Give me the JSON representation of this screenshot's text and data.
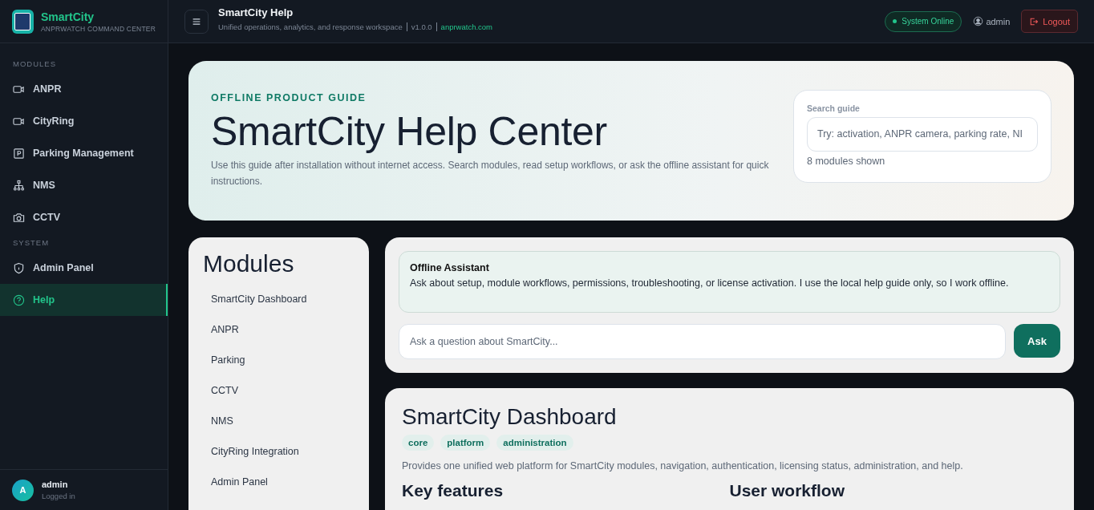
{
  "brand": {
    "name": "SmartCity",
    "subtitle": "ANPRWATCH COMMAND CENTER"
  },
  "sidebar": {
    "sections": [
      {
        "title": "MODULES",
        "items": [
          {
            "label": "ANPR",
            "kind": "camera",
            "selected": false
          },
          {
            "label": "CityRing",
            "kind": "camera",
            "selected": false
          },
          {
            "label": "Parking Management",
            "kind": "parking",
            "selected": false
          },
          {
            "label": "NMS",
            "kind": "network",
            "selected": false
          },
          {
            "label": "CCTV",
            "kind": "photo",
            "selected": false
          }
        ]
      },
      {
        "title": "SYSTEM",
        "items": [
          {
            "label": "Admin Panel",
            "kind": "shield",
            "selected": false
          },
          {
            "label": "Help",
            "kind": "help",
            "selected": true
          }
        ]
      }
    ],
    "user": {
      "initial": "A",
      "name": "admin",
      "status": "Logged in"
    }
  },
  "header": {
    "title": "SmartCity Help",
    "subtitle": "Unified operations, analytics, and response workspace",
    "version": "v1.0.0",
    "link": "anprwatch.com",
    "status": "System Online",
    "user": "admin",
    "logout": "Logout"
  },
  "hero": {
    "eyebrow": "OFFLINE PRODUCT GUIDE",
    "title": "SmartCity Help Center",
    "description": "Use this guide after installation without internet access. Search modules, read setup workflows, or ask the offline assistant for quick instructions.",
    "search": {
      "label": "Search guide",
      "placeholder": "Try: activation, ANPR camera, parking rate, NI",
      "count": "8 modules shown"
    }
  },
  "modules": {
    "title": "Modules",
    "items": [
      "SmartCity Dashboard",
      "ANPR",
      "Parking",
      "CCTV",
      "NMS",
      "CityRing Integration",
      "Admin Panel"
    ]
  },
  "assistant": {
    "title": "Offline Assistant",
    "message": "Ask about setup, module workflows, permissions, troubleshooting, or license activation. I use the local help guide only, so I work offline.",
    "placeholder": "Ask a question about SmartCity...",
    "button": "Ask"
  },
  "detail": {
    "title": "SmartCity Dashboard",
    "tags": [
      "core",
      "platform",
      "administration"
    ],
    "description": "Provides one unified web platform for SmartCity modules, navigation, authentication, licensing status, administration, and help.",
    "sections": [
      "Key features",
      "User workflow"
    ]
  }
}
